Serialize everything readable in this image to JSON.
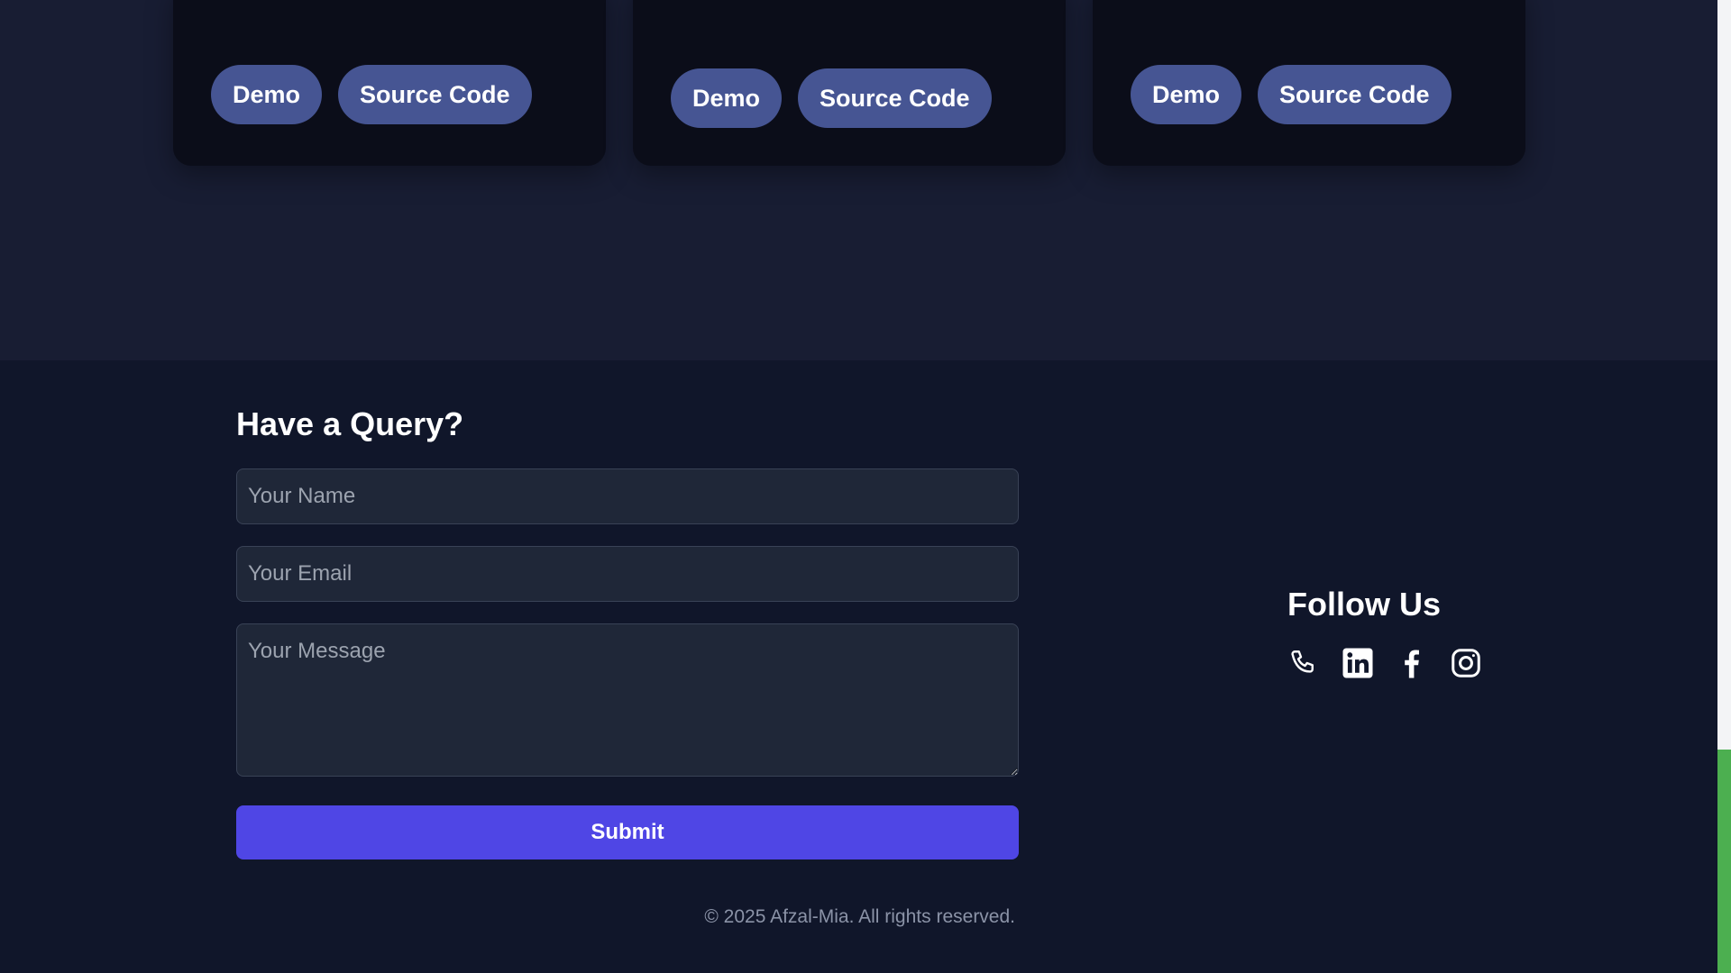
{
  "projects": {
    "cards": [
      {
        "demo_label": "Demo",
        "source_label": "Source Code"
      },
      {
        "demo_label": "Demo",
        "source_label": "Source Code"
      },
      {
        "demo_label": "Demo",
        "source_label": "Source Code"
      }
    ]
  },
  "contact": {
    "title": "Have a Query?",
    "name_placeholder": "Your Name",
    "email_placeholder": "Your Email",
    "message_placeholder": "Your Message",
    "submit_label": "Submit"
  },
  "follow": {
    "title": "Follow Us",
    "icons": [
      "phone-icon",
      "linkedin-icon",
      "facebook-icon",
      "instagram-icon"
    ]
  },
  "footer": {
    "copyright": "© 2025 Afzal-Mia. All rights reserved."
  },
  "scroll": {
    "position": 0.77,
    "visible_fraction": 0.23
  },
  "colors": {
    "page_bg": "#181d33",
    "card_bg": "#0b0d19",
    "pill_button": "#465593",
    "footer_bg": "#10162a",
    "input_bg": "#1f2738",
    "submit_accent": "#4f46e5",
    "scroll_thumb": "#4caf50"
  }
}
